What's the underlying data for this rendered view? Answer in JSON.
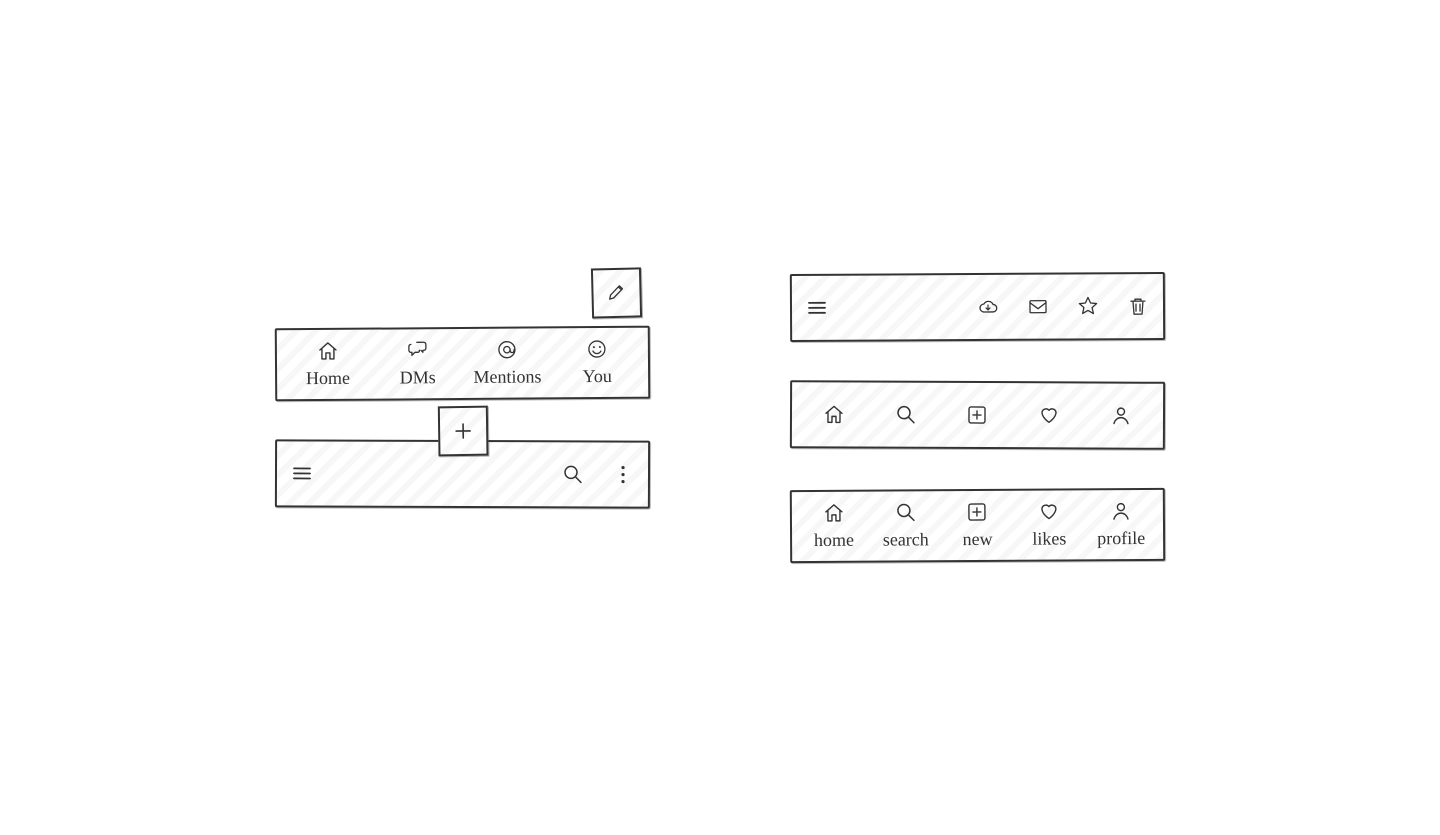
{
  "panel1": {
    "items": [
      {
        "label": "Home"
      },
      {
        "label": "DMs"
      },
      {
        "label": "Mentions"
      },
      {
        "label": "You"
      }
    ]
  },
  "panel5": {
    "items": [
      {
        "label": "home"
      },
      {
        "label": "search"
      },
      {
        "label": "new"
      },
      {
        "label": "likes"
      },
      {
        "label": "profile"
      }
    ]
  }
}
